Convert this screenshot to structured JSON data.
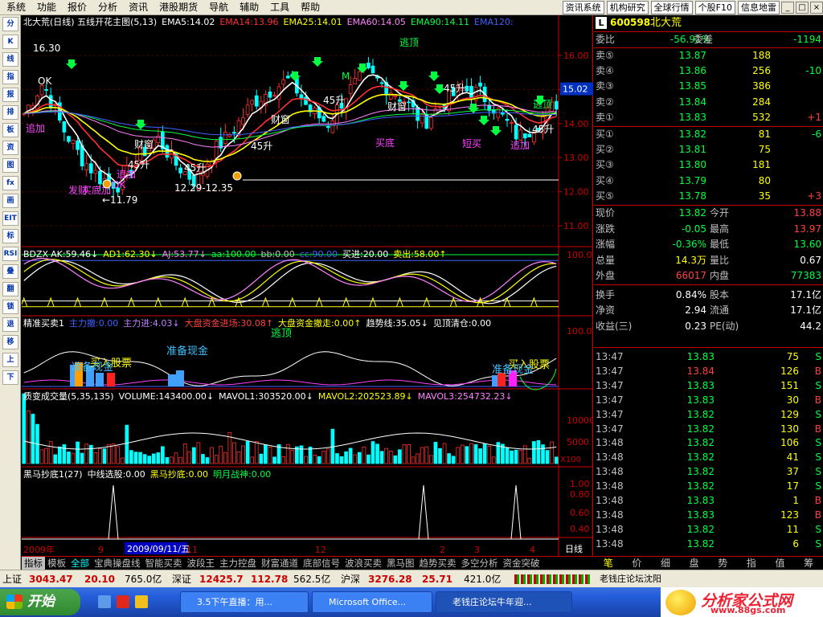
{
  "menu": {
    "items": [
      "系统",
      "功能",
      "报价",
      "分析",
      "资讯",
      "港股期货",
      "导航",
      "辅助",
      "工具",
      "帮助"
    ],
    "right_buttons": [
      "资讯系统",
      "机构研究",
      "全球行情",
      "个股F10",
      "信息地雷"
    ]
  },
  "left_toolbar": [
    "分",
    "K",
    "线",
    "指",
    "报",
    "排",
    "板",
    "资",
    "图",
    "fx",
    "画",
    "EIT",
    "标",
    "RSI",
    "叠",
    "翻",
    "锁",
    "退",
    "移",
    "上",
    "下"
  ],
  "main_panel": {
    "title": "北大荒(日线) 五线开花主图(5,13)",
    "ema": [
      {
        "text": "EMA5:14.02",
        "color": "#ffffff"
      },
      {
        "text": "EMA14:13.96",
        "color": "#ff3030"
      },
      {
        "text": "EMA25:14.01",
        "color": "#ffff00"
      },
      {
        "text": "EMA60:14.05",
        "color": "#ff80ff"
      },
      {
        "text": "EMA90:14.11",
        "color": "#00ff40"
      },
      {
        "text": "EMA120:",
        "color": "#4060ff"
      }
    ],
    "y_ticks": [
      "16.00",
      "15.00",
      "14.00",
      "13.00",
      "12.00",
      "11.00"
    ],
    "current_price": "15.02",
    "annotations": [
      {
        "text": "16.30",
        "color": "#ffffff"
      },
      {
        "text": "←11.79",
        "color": "#ffffff"
      },
      {
        "text": "12.29-12.35",
        "color": "#ffffff"
      },
      {
        "text": "逃顶",
        "color": "#00ff40"
      },
      {
        "text": "逃顶",
        "color": "#00ff40"
      },
      {
        "text": "45升",
        "color": "#ffffff"
      },
      {
        "text": "45升",
        "color": "#ffffff"
      },
      {
        "text": "45升",
        "color": "#ffffff"
      },
      {
        "text": "45升",
        "color": "#ffffff"
      },
      {
        "text": "45升",
        "color": "#ffffff"
      },
      {
        "text": "45升",
        "color": "#ffffff"
      },
      {
        "text": "买底",
        "color": "#ff40ff"
      },
      {
        "text": "短买",
        "color": "#ff40ff"
      },
      {
        "text": "追加",
        "color": "#ff40ff"
      },
      {
        "text": "追加",
        "color": "#ff40ff"
      },
      {
        "text": "追加",
        "color": "#ff40ff"
      },
      {
        "text": "发财",
        "color": "#ff40ff"
      },
      {
        "text": "财窗",
        "color": "#ffffff"
      },
      {
        "text": "财窗",
        "color": "#ffffff"
      },
      {
        "text": "财窗",
        "color": "#ffffff"
      },
      {
        "text": "买底加",
        "color": "#ff40ff"
      },
      {
        "text": "OK",
        "color": "#ffffff"
      },
      {
        "text": "OK",
        "color": "#ff40ff"
      },
      {
        "text": "M",
        "color": "#00ff40"
      }
    ]
  },
  "bdzx_panel": {
    "title": "BDZX",
    "values": [
      {
        "text": "AK:59.46↓",
        "color": "#ffffff"
      },
      {
        "text": "AD1:62.30↓",
        "color": "#ffff00"
      },
      {
        "text": "AJ:53.77↓",
        "color": "#ff80ff"
      },
      {
        "text": "aa:100.00",
        "color": "#00ff40"
      },
      {
        "text": "bb:0.00",
        "color": "#c0c0c0"
      },
      {
        "text": "cc:90.00",
        "color": "#4060ff"
      },
      {
        "text": "买进:20.00",
        "color": "#ffffff"
      },
      {
        "text": "卖出:58.00↑",
        "color": "#ffff00"
      }
    ],
    "y_tick": "100.0"
  },
  "jz_panel": {
    "title": "精准买卖1",
    "values": [
      {
        "text": "主力撤:0.00",
        "color": "#4060ff"
      },
      {
        "text": "主力进:4.03↓",
        "color": "#c080ff"
      },
      {
        "text": "大盘资金进场:30.08↑",
        "color": "#ff4040"
      },
      {
        "text": "大盘资金撤走:0.00↑",
        "color": "#ffff00"
      },
      {
        "text": "趋势线:35.05↓",
        "color": "#ffffff"
      },
      {
        "text": "见顶清仓:0.00",
        "color": "#ffffff"
      }
    ],
    "labels": [
      {
        "text": "买入股票",
        "color": "#ffff00"
      },
      {
        "text": "准备现金",
        "color": "#40c0ff"
      },
      {
        "text": "买入股票",
        "color": "#ffff00"
      },
      {
        "text": "准备现金",
        "color": "#40c0ff"
      },
      {
        "text": "准备现金",
        "color": "#40c0ff"
      },
      {
        "text": "逃顶",
        "color": "#00ff40"
      }
    ],
    "y_tick": "100.0"
  },
  "vol_panel": {
    "title": "质变成交量(5,35,135)",
    "values": [
      {
        "text": "VOLUME:143400.00↓",
        "color": "#ffffff"
      },
      {
        "text": "MAVOL1:303520.00↓",
        "color": "#ffffff"
      },
      {
        "text": "MAVOL2:202523.89↓",
        "color": "#ffff00"
      },
      {
        "text": "MAVOL3:254732.23↓",
        "color": "#ff80ff"
      }
    ],
    "y_ticks": [
      "10000",
      "5000"
    ],
    "unit": "X100"
  },
  "hm_panel": {
    "title": "黑马抄底1(27)",
    "values": [
      {
        "text": "中线选股:0.00",
        "color": "#ffffff"
      },
      {
        "text": "黑马抄底:0.00",
        "color": "#ffff00"
      },
      {
        "text": "明月战神:0.00",
        "color": "#00ff40"
      }
    ],
    "y_ticks": [
      "1.00",
      "0.80",
      "0.60",
      "0.40",
      "0.20"
    ]
  },
  "x_axis": {
    "labels": [
      "2009年",
      "9",
      "11",
      "12",
      "2",
      "3",
      "4"
    ],
    "cursor_date": "2009/09/11/五",
    "period": "日线"
  },
  "tabs": [
    "指标",
    "模板",
    "全部",
    "宝典操盘线",
    "智能买卖",
    "波段王",
    "主力控盘",
    "财富通道",
    "底部信号",
    "波浪买卖",
    "黑马图",
    "趋势买卖",
    "多空分析",
    "资金突破"
  ],
  "quote": {
    "code": "600598",
    "name": "北大荒",
    "weibi_label": "委比",
    "weibi": "-56.91%",
    "weicha_label": "委差",
    "weicha": "-1194",
    "sell": [
      {
        "label": "卖⑤",
        "price": "13.87",
        "vol": "188",
        "chg": ""
      },
      {
        "label": "卖④",
        "price": "13.86",
        "vol": "256",
        "chg": "-10"
      },
      {
        "label": "卖③",
        "price": "13.85",
        "vol": "386",
        "chg": ""
      },
      {
        "label": "卖②",
        "price": "13.84",
        "vol": "284",
        "chg": ""
      },
      {
        "label": "卖①",
        "price": "13.83",
        "vol": "532",
        "chg": "+1"
      }
    ],
    "buy": [
      {
        "label": "买①",
        "price": "13.82",
        "vol": "81",
        "chg": "-6"
      },
      {
        "label": "买②",
        "price": "13.81",
        "vol": "75",
        "chg": ""
      },
      {
        "label": "买③",
        "price": "13.80",
        "vol": "181",
        "chg": ""
      },
      {
        "label": "买④",
        "price": "13.79",
        "vol": "80",
        "chg": ""
      },
      {
        "label": "买⑤",
        "price": "13.78",
        "vol": "35",
        "chg": "+3"
      }
    ],
    "stats": [
      {
        "l1": "现价",
        "v1": "13.82",
        "c1": "#00ff40",
        "l2": "今开",
        "v2": "13.88",
        "c2": "#ff4040"
      },
      {
        "l1": "涨跌",
        "v1": "-0.05",
        "c1": "#00ff40",
        "l2": "最高",
        "v2": "13.97",
        "c2": "#ff4040"
      },
      {
        "l1": "涨幅",
        "v1": "-0.36%",
        "c1": "#00ff40",
        "l2": "最低",
        "v2": "13.60",
        "c2": "#00ff40"
      },
      {
        "l1": "总量",
        "v1": "14.3万",
        "c1": "#ffff00",
        "l2": "量比",
        "v2": "0.67",
        "c2": "#ffffff"
      },
      {
        "l1": "外盘",
        "v1": "66017",
        "c1": "#ff4040",
        "l2": "内盘",
        "v2": "77383",
        "c2": "#00ff40"
      },
      {
        "l1": "换手",
        "v1": "0.84%",
        "c1": "#ffffff",
        "l2": "股本",
        "v2": "17.1亿",
        "c2": "#ffffff"
      },
      {
        "l1": "净资",
        "v1": "2.94",
        "c1": "#ffffff",
        "l2": "流通",
        "v2": "17.1亿",
        "c2": "#ffffff"
      },
      {
        "l1": "收益(三)",
        "v1": "0.23",
        "c1": "#ffffff",
        "l2": "PE(动)",
        "v2": "44.2",
        "c2": "#ffffff"
      }
    ],
    "ticks": [
      {
        "t": "13:47",
        "p": "13.83",
        "v": "75",
        "s": "S"
      },
      {
        "t": "13:47",
        "p": "13.84",
        "v": "126",
        "s": "B"
      },
      {
        "t": "13:47",
        "p": "13.83",
        "v": "151",
        "s": "S"
      },
      {
        "t": "13:47",
        "p": "13.83",
        "v": "30",
        "s": "B"
      },
      {
        "t": "13:47",
        "p": "13.82",
        "v": "129",
        "s": "S"
      },
      {
        "t": "13:47",
        "p": "13.82",
        "v": "130",
        "s": "B"
      },
      {
        "t": "13:48",
        "p": "13.82",
        "v": "106",
        "s": "S"
      },
      {
        "t": "13:48",
        "p": "13.82",
        "v": "41",
        "s": "S"
      },
      {
        "t": "13:48",
        "p": "13.82",
        "v": "37",
        "s": "S"
      },
      {
        "t": "13:48",
        "p": "13.82",
        "v": "17",
        "s": "S"
      },
      {
        "t": "13:48",
        "p": "13.83",
        "v": "1",
        "s": "B"
      },
      {
        "t": "13:48",
        "p": "13.83",
        "v": "123",
        "s": "B"
      },
      {
        "t": "13:48",
        "p": "13.82",
        "v": "11",
        "s": "S"
      },
      {
        "t": "13:48",
        "p": "13.82",
        "v": "6",
        "s": "S"
      }
    ],
    "tabs": [
      "笔",
      "价",
      "细",
      "盘",
      "势",
      "指",
      "值",
      "筹"
    ]
  },
  "statusbar": {
    "sh_label": "上证",
    "sh_val": "3043.47",
    "sh_chg": "20.10",
    "sh_amt": "765.0亿",
    "sz_label": "深证",
    "sz_val": "12425.7",
    "sz_chg": "112.78",
    "sz_amt": "562.5亿",
    "hs_label": "沪深",
    "hs_val": "3276.28",
    "hs_chg": "25.71",
    "hs_amt": "421.0亿",
    "marquee": "老钱庄论坛沈阳"
  },
  "taskbar": {
    "start": "开始",
    "tasks": [
      "3.5下午直播：用...",
      "Microsoft Office...",
      "老钱庄论坛牛年迎..."
    ],
    "brand1": "分析家公式网",
    "brand2": "www.88gs.com"
  }
}
